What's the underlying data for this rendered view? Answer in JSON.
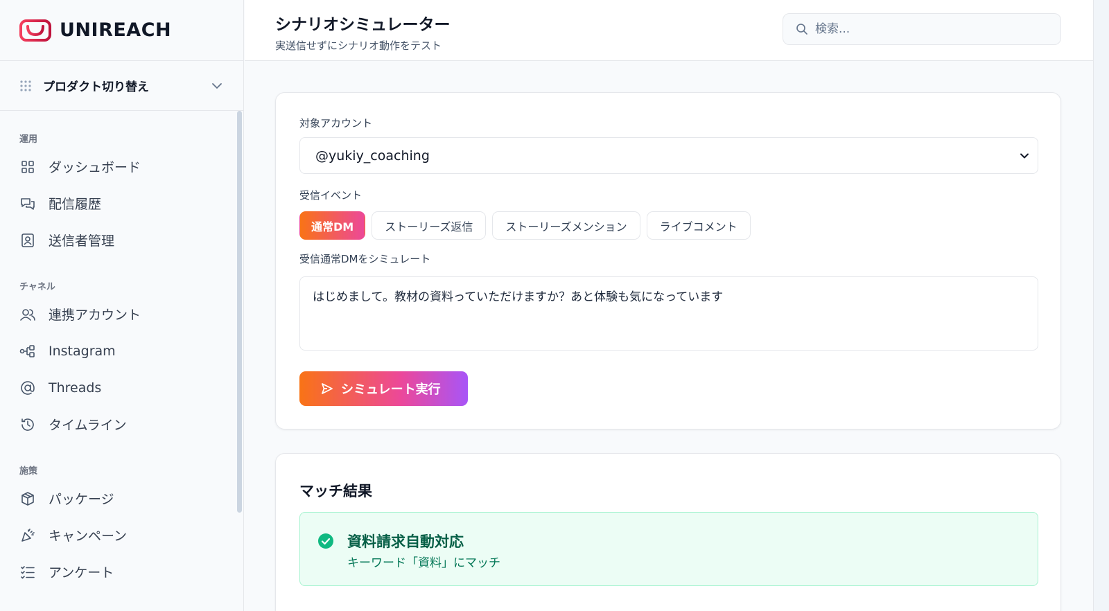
{
  "brand": {
    "name": "UNIREACH",
    "accent": "#e11d48"
  },
  "product_switcher": {
    "label": "プロダクト切り替え"
  },
  "sidebar": {
    "sections": [
      {
        "title": "運用",
        "items": [
          {
            "label": "ダッシュボード",
            "icon": "grid-icon"
          },
          {
            "label": "配信履歴",
            "icon": "chat-icon"
          },
          {
            "label": "送信者管理",
            "icon": "contact-icon"
          }
        ]
      },
      {
        "title": "チャネル",
        "items": [
          {
            "label": "連携アカウント",
            "icon": "users-icon"
          },
          {
            "label": "Instagram",
            "icon": "flow-icon"
          },
          {
            "label": "Threads",
            "icon": "at-icon"
          },
          {
            "label": "タイムライン",
            "icon": "history-icon"
          }
        ]
      },
      {
        "title": "施策",
        "items": [
          {
            "label": "パッケージ",
            "icon": "package-icon"
          },
          {
            "label": "キャンペーン",
            "icon": "party-icon"
          },
          {
            "label": "アンケート",
            "icon": "checklist-icon"
          }
        ]
      }
    ]
  },
  "header": {
    "title": "シナリオシミュレーター",
    "subtitle": "実送信せずにシナリオ動作をテスト",
    "search_placeholder": "検索..."
  },
  "simulator": {
    "account_label": "対象アカウント",
    "account_value": "@yukiy_coaching",
    "event_label": "受信イベント",
    "events": [
      {
        "label": "通常DM",
        "active": true
      },
      {
        "label": "ストーリーズ返信",
        "active": false
      },
      {
        "label": "ストーリーズメンション",
        "active": false
      },
      {
        "label": "ライブコメント",
        "active": false
      }
    ],
    "message_label": "受信通常DMをシミュレート",
    "message_value": "はじめまして。教材の資料っていただけますか？あと体験も気になっています",
    "run_label": "シミュレート実行"
  },
  "result": {
    "title": "マッチ結果",
    "match_name": "資料請求自動対応",
    "match_reason": "キーワード「資料」にマッチ"
  }
}
